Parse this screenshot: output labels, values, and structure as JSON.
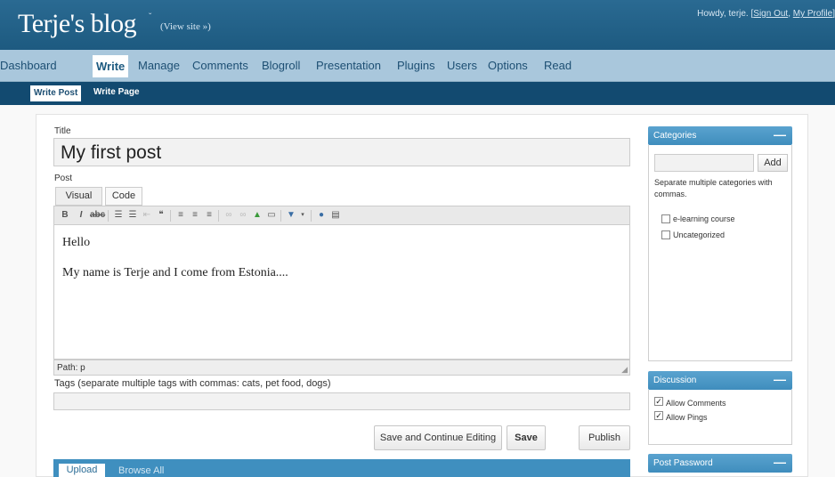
{
  "header": {
    "blog_title": "Terje's blog",
    "view_site": "(View site »)",
    "howdy": "Howdy, terje.",
    "sign_out": "Sign Out",
    "my_profile": "My Profile"
  },
  "nav": {
    "items": [
      "Dashboard",
      "Write",
      "Manage",
      "Comments",
      "Blogroll",
      "Presentation",
      "Plugins",
      "Users",
      "Options",
      "Read"
    ],
    "active": "Write"
  },
  "subnav": {
    "items": [
      "Write Post",
      "Write Page"
    ],
    "active": "Write Post"
  },
  "post": {
    "title_label": "Title",
    "title_value": "My first post",
    "post_label": "Post",
    "tab_visual": "Visual",
    "tab_code": "Code",
    "content_line1": "Hello",
    "content_line2": "My name is Terje and I come from Estonia....",
    "path": "Path: p",
    "tags_label": "Tags (separate multiple tags with commas: cats, pet food, dogs)",
    "tags_value": ""
  },
  "buttons": {
    "save_continue": "Save and Continue Editing",
    "save": "Save",
    "publish": "Publish"
  },
  "upload": {
    "tab_upload": "Upload",
    "tab_browse": "Browse All"
  },
  "sidebar": {
    "categories_title": "Categories",
    "add_label": "Add",
    "category_hint": "Separate multiple categories with commas.",
    "categories": [
      {
        "label": "e-learning course",
        "checked": false
      },
      {
        "label": "Uncategorized",
        "checked": false
      }
    ],
    "discussion_title": "Discussion",
    "allow_comments": "Allow Comments",
    "allow_pings": "Allow Pings",
    "password_title": "Post Password",
    "collapse_symbol": "—"
  },
  "colors": {
    "header_bg": "#2a6a92",
    "nav_bg": "#a9c7dc",
    "subnav_bg": "#124a70",
    "accent": "#3f8dbd"
  }
}
